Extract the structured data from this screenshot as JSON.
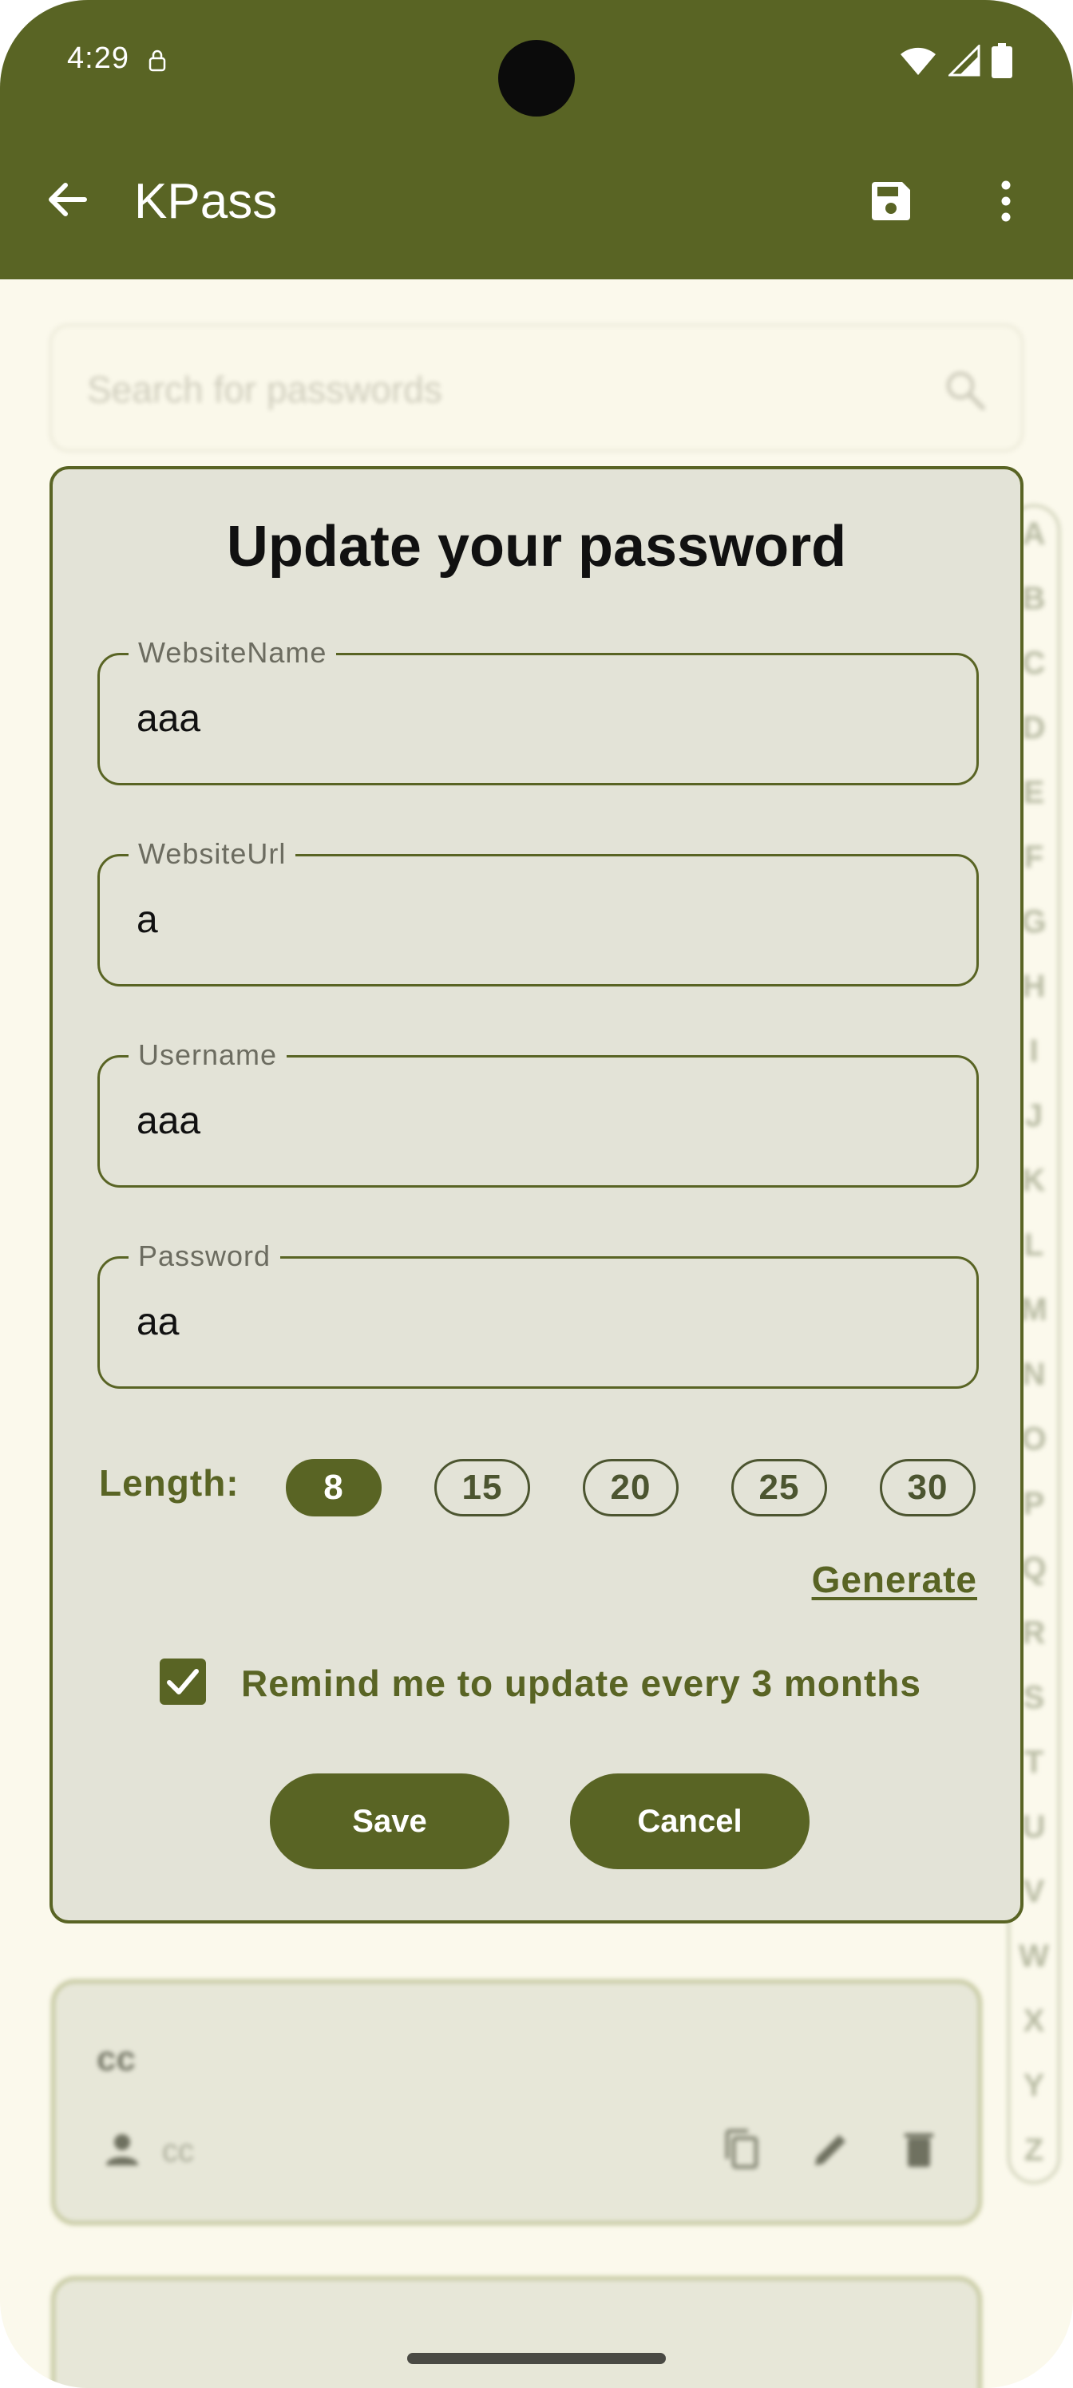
{
  "status_bar": {
    "time": "4:29"
  },
  "app_bar": {
    "title": "KPass"
  },
  "search": {
    "placeholder": "Search for passwords"
  },
  "alphabet": [
    "A",
    "B",
    "C",
    "D",
    "E",
    "F",
    "G",
    "H",
    "I",
    "J",
    "K",
    "L",
    "M",
    "N",
    "O",
    "P",
    "Q",
    "R",
    "S",
    "T",
    "U",
    "V",
    "W",
    "X",
    "Y",
    "Z"
  ],
  "background_card": {
    "title": "cc",
    "username": "cc"
  },
  "dialog": {
    "title": "Update your password",
    "fields": [
      {
        "label": "WebsiteName",
        "value": "aaa"
      },
      {
        "label": "WebsiteUrl",
        "value": "a"
      },
      {
        "label": "Username",
        "value": "aaa"
      },
      {
        "label": "Password",
        "value": "aa"
      }
    ],
    "length_label": "Length:",
    "length_options": [
      "8",
      "15",
      "20",
      "25",
      "30"
    ],
    "selected_length": "8",
    "generate_label": "Generate",
    "remind_label": "Remind me to update every 3 months",
    "remind_checked": true,
    "save_label": "Save",
    "cancel_label": "Cancel"
  },
  "colors": {
    "primary": "#596424",
    "background": "#fbf9ec",
    "dialog_surface": "#e3e3d7"
  }
}
